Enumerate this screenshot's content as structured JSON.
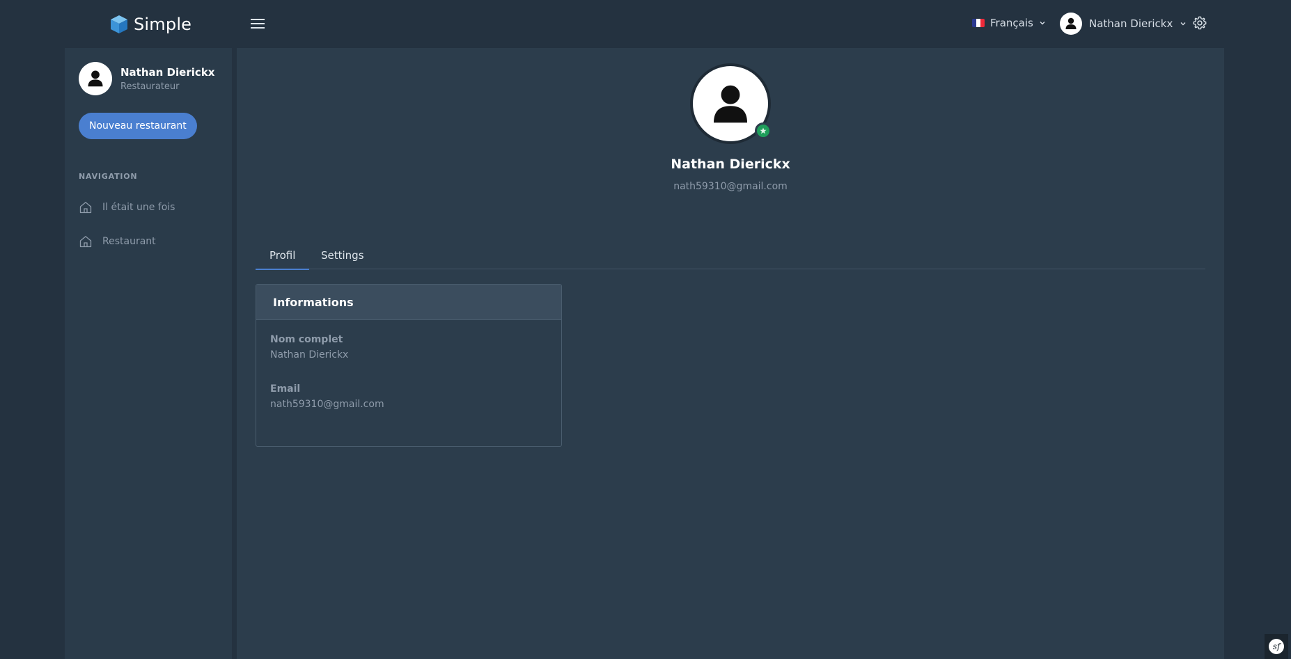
{
  "app": {
    "brand_name": "Simple"
  },
  "header": {
    "language_label": "Français",
    "user_name": "Nathan Dierickx",
    "flag_colors": [
      "#2b3990",
      "#ffffff",
      "#ed2939"
    ]
  },
  "sidebar": {
    "user_name": "Nathan Dierickx",
    "user_role": "Restaurateur",
    "new_button_label": "Nouveau restaurant",
    "nav_title": "NAVIGATION",
    "items": [
      {
        "label": "Il était une fois",
        "icon": "home-icon"
      },
      {
        "label": "Restaurant",
        "icon": "home-icon"
      }
    ]
  },
  "profile": {
    "name": "Nathan Dierickx",
    "email": "nath59310@gmail.com",
    "status": "online"
  },
  "tabs": [
    {
      "label": "Profil",
      "active": true
    },
    {
      "label": "Settings",
      "active": false
    }
  ],
  "info_card": {
    "title": "Informations",
    "fields": [
      {
        "label": "Nom complet",
        "value": "Nathan Dierickx"
      },
      {
        "label": "Email",
        "value": "nath59310@gmail.com"
      }
    ]
  },
  "colors": {
    "accent": "#4a7fd0",
    "online": "#1f9e5b",
    "background": "#243240",
    "panel": "#2c3d4c"
  }
}
